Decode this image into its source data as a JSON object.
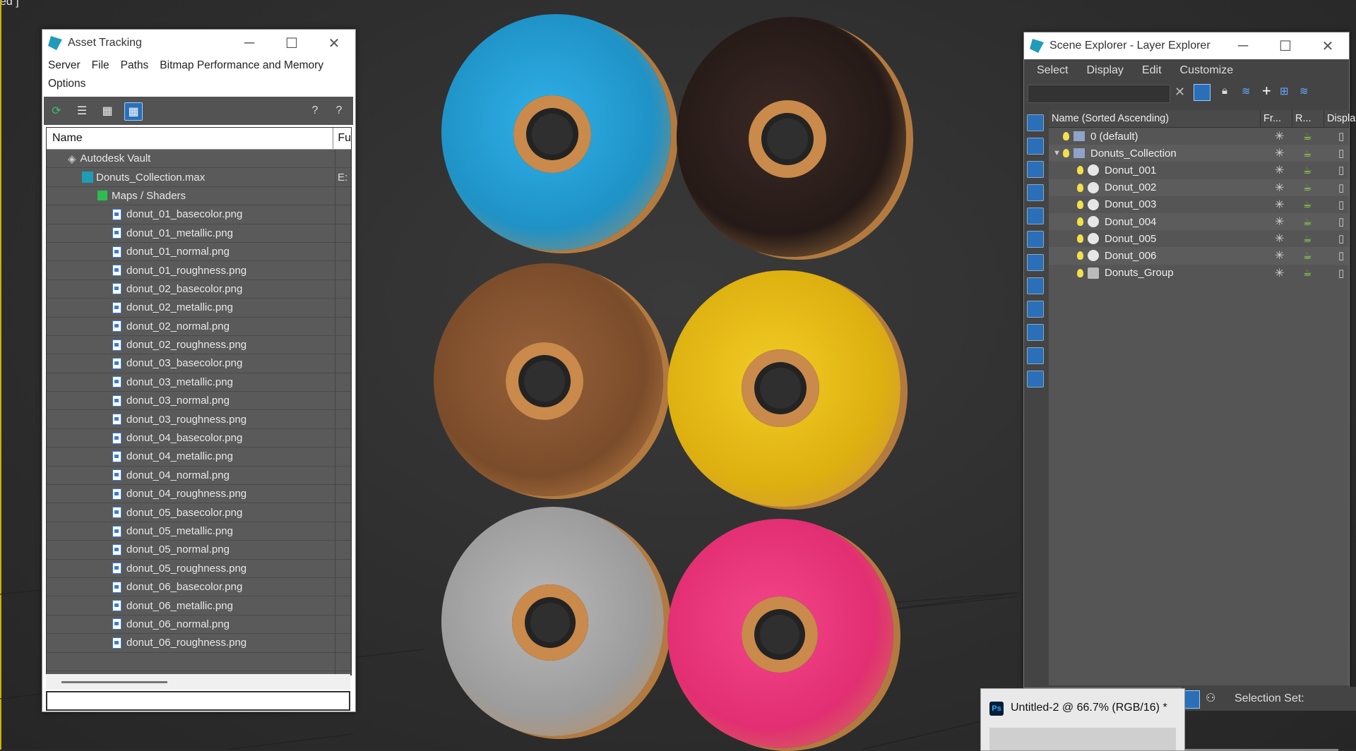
{
  "viewport": {
    "label": "ed ]"
  },
  "asset_tracking": {
    "title": "Asset Tracking",
    "menu": [
      "Server",
      "File",
      "Paths",
      "Bitmap Performance and Memory",
      "Options"
    ],
    "columns": [
      "Name",
      "Fu"
    ],
    "rows": [
      {
        "name": "Autodesk Vault",
        "level": 1,
        "icon": "vault-icon",
        "extra": ""
      },
      {
        "name": "Donuts_Collection.max",
        "level": 2,
        "icon": "max-file-icon",
        "extra": "E:"
      },
      {
        "name": "Maps / Shaders",
        "level": 3,
        "icon": "maps-shaders-icon",
        "extra": ""
      },
      {
        "name": "donut_01_basecolor.png",
        "level": 4,
        "icon": "image-file-icon",
        "extra": ""
      },
      {
        "name": "donut_01_metallic.png",
        "level": 4,
        "icon": "image-file-icon",
        "extra": ""
      },
      {
        "name": "donut_01_normal.png",
        "level": 4,
        "icon": "image-file-icon",
        "extra": ""
      },
      {
        "name": "donut_01_roughness.png",
        "level": 4,
        "icon": "image-file-icon",
        "extra": ""
      },
      {
        "name": "donut_02_basecolor.png",
        "level": 4,
        "icon": "image-file-icon",
        "extra": ""
      },
      {
        "name": "donut_02_metallic.png",
        "level": 4,
        "icon": "image-file-icon",
        "extra": ""
      },
      {
        "name": "donut_02_normal.png",
        "level": 4,
        "icon": "image-file-icon",
        "extra": ""
      },
      {
        "name": "donut_02_roughness.png",
        "level": 4,
        "icon": "image-file-icon",
        "extra": ""
      },
      {
        "name": "donut_03_basecolor.png",
        "level": 4,
        "icon": "image-file-icon",
        "extra": ""
      },
      {
        "name": "donut_03_metallic.png",
        "level": 4,
        "icon": "image-file-icon",
        "extra": ""
      },
      {
        "name": "donut_03_normal.png",
        "level": 4,
        "icon": "image-file-icon",
        "extra": ""
      },
      {
        "name": "donut_03_roughness.png",
        "level": 4,
        "icon": "image-file-icon",
        "extra": ""
      },
      {
        "name": "donut_04_basecolor.png",
        "level": 4,
        "icon": "image-file-icon",
        "extra": ""
      },
      {
        "name": "donut_04_metallic.png",
        "level": 4,
        "icon": "image-file-icon",
        "extra": ""
      },
      {
        "name": "donut_04_normal.png",
        "level": 4,
        "icon": "image-file-icon",
        "extra": ""
      },
      {
        "name": "donut_04_roughness.png",
        "level": 4,
        "icon": "image-file-icon",
        "extra": ""
      },
      {
        "name": "donut_05_basecolor.png",
        "level": 4,
        "icon": "image-file-icon",
        "extra": ""
      },
      {
        "name": "donut_05_metallic.png",
        "level": 4,
        "icon": "image-file-icon",
        "extra": ""
      },
      {
        "name": "donut_05_normal.png",
        "level": 4,
        "icon": "image-file-icon",
        "extra": ""
      },
      {
        "name": "donut_05_roughness.png",
        "level": 4,
        "icon": "image-file-icon",
        "extra": ""
      },
      {
        "name": "donut_06_basecolor.png",
        "level": 4,
        "icon": "image-file-icon",
        "extra": ""
      },
      {
        "name": "donut_06_metallic.png",
        "level": 4,
        "icon": "image-file-icon",
        "extra": ""
      },
      {
        "name": "donut_06_normal.png",
        "level": 4,
        "icon": "image-file-icon",
        "extra": ""
      },
      {
        "name": "donut_06_roughness.png",
        "level": 4,
        "icon": "image-file-icon",
        "extra": ""
      }
    ]
  },
  "scene_explorer": {
    "title": "Scene Explorer - Layer Explorer",
    "menu": [
      "Select",
      "Display",
      "Edit",
      "Customize"
    ],
    "columns": [
      "Name (Sorted Ascending)",
      "Fr...",
      "R...",
      "Displa"
    ],
    "rows": [
      {
        "name": "0 (default)",
        "level": 0,
        "type": "layer",
        "expander": ""
      },
      {
        "name": "Donuts_Collection",
        "level": 0,
        "type": "layer",
        "expander": "▼"
      },
      {
        "name": "Donut_001",
        "level": 1,
        "type": "object",
        "expander": ""
      },
      {
        "name": "Donut_002",
        "level": 1,
        "type": "object",
        "expander": ""
      },
      {
        "name": "Donut_003",
        "level": 1,
        "type": "object",
        "expander": ""
      },
      {
        "name": "Donut_004",
        "level": 1,
        "type": "object",
        "expander": ""
      },
      {
        "name": "Donut_005",
        "level": 1,
        "type": "object",
        "expander": ""
      },
      {
        "name": "Donut_006",
        "level": 1,
        "type": "object",
        "expander": ""
      },
      {
        "name": "Donuts_Group",
        "level": 1,
        "type": "group",
        "expander": ""
      }
    ],
    "selection_sets_label": "Selection Set:"
  },
  "photoshop_thumbnail": {
    "title": "Untitled-2 @ 66.7% (RGB/16) *",
    "app_icon_text": "Ps"
  },
  "colors": {
    "viewport_bg": "#2e2e2e",
    "donut_glazes": [
      "#2aa3d8",
      "#2d1f1c",
      "#8a5530",
      "#e6be15",
      "#a9a9a9",
      "#f0397e"
    ],
    "dough": "#c98a4b"
  }
}
